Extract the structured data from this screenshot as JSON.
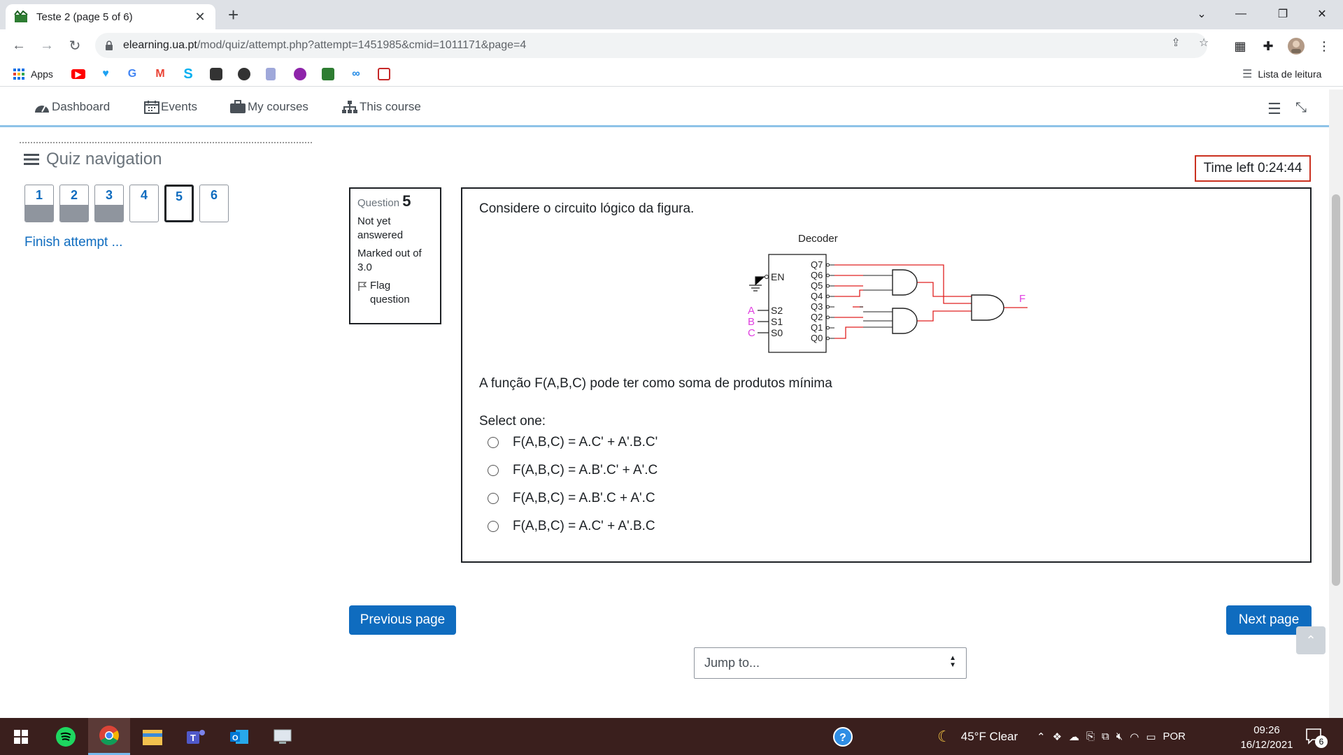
{
  "browser": {
    "tab_title": "Teste 2 (page 5 of 6)",
    "tab_close": "✕",
    "new_tab": "+",
    "window_controls": {
      "dropdown": "⌄",
      "minimize": "—",
      "restore": "❐",
      "close": "✕"
    },
    "url_host": "elearning.ua.pt",
    "url_path": "/mod/quiz/attempt.php?attempt=1451985&cmid=1011171&page=4",
    "bookmarks": {
      "apps_label": "Apps",
      "reading_list": "Lista de leitura",
      "icons": [
        "youtube-icon",
        "twitter-icon",
        "google-icon",
        "gmail-icon",
        "skype-icon",
        "bot-icon",
        "colors-icon",
        "doc-icon",
        "podcast-icon",
        "moodle-icon",
        "swirl-icon",
        "calendar-icon"
      ]
    }
  },
  "navbar": {
    "dashboard": "Dashboard",
    "events": "Events",
    "my_courses": "My courses",
    "this_course": "This course"
  },
  "quiz_nav": {
    "title": "Quiz navigation",
    "buttons": [
      {
        "label": "1",
        "answered": true
      },
      {
        "label": "2",
        "answered": true
      },
      {
        "label": "3",
        "answered": true
      },
      {
        "label": "4",
        "answered": false
      },
      {
        "label": "5",
        "answered": false,
        "current": true
      },
      {
        "label": "6",
        "answered": false
      }
    ],
    "finish": "Finish attempt ..."
  },
  "timer": "Time left 0:24:44",
  "question_info": {
    "label": "Question",
    "number": "5",
    "state": "Not yet answered",
    "marks": "Marked out of 3.0",
    "flag": "Flag question"
  },
  "question": {
    "text": "Considere o circuito lógico da figura.",
    "prompt": "A função F(A,B,C) pode ter como soma de produtos mínima",
    "select_one": "Select one:",
    "options": [
      "F(A,B,C) = A.C' + A'.B.C'",
      "F(A,B,C) = A.B'.C' + A'.C",
      "F(A,B,C) = A.B'.C + A'.C",
      "F(A,B,C) = A.C' + A'.B.C"
    ],
    "circuit": {
      "title": "Decoder",
      "enable": "EN",
      "inputs": [
        "A",
        "B",
        "C"
      ],
      "selects": [
        "S2",
        "S1",
        "S0"
      ],
      "outputs": [
        "Q7",
        "Q6",
        "Q5",
        "Q4",
        "Q3",
        "Q2",
        "Q1",
        "Q0"
      ],
      "output_label": "F",
      "input_color": "#e040e0",
      "wire_color": "#e02020"
    }
  },
  "buttons": {
    "previous": "Previous page",
    "next": "Next page",
    "jump": "Jump to..."
  },
  "taskbar": {
    "weather": "45°F  Clear",
    "language": "POR",
    "time": "09:26",
    "date": "16/12/2021",
    "notification_count": "6",
    "accent": "#3a1f1d"
  },
  "colors": {
    "primary": "#0f6cbf",
    "timer_border": "#ca3120",
    "navbar_accent": "#8ec3e8"
  }
}
